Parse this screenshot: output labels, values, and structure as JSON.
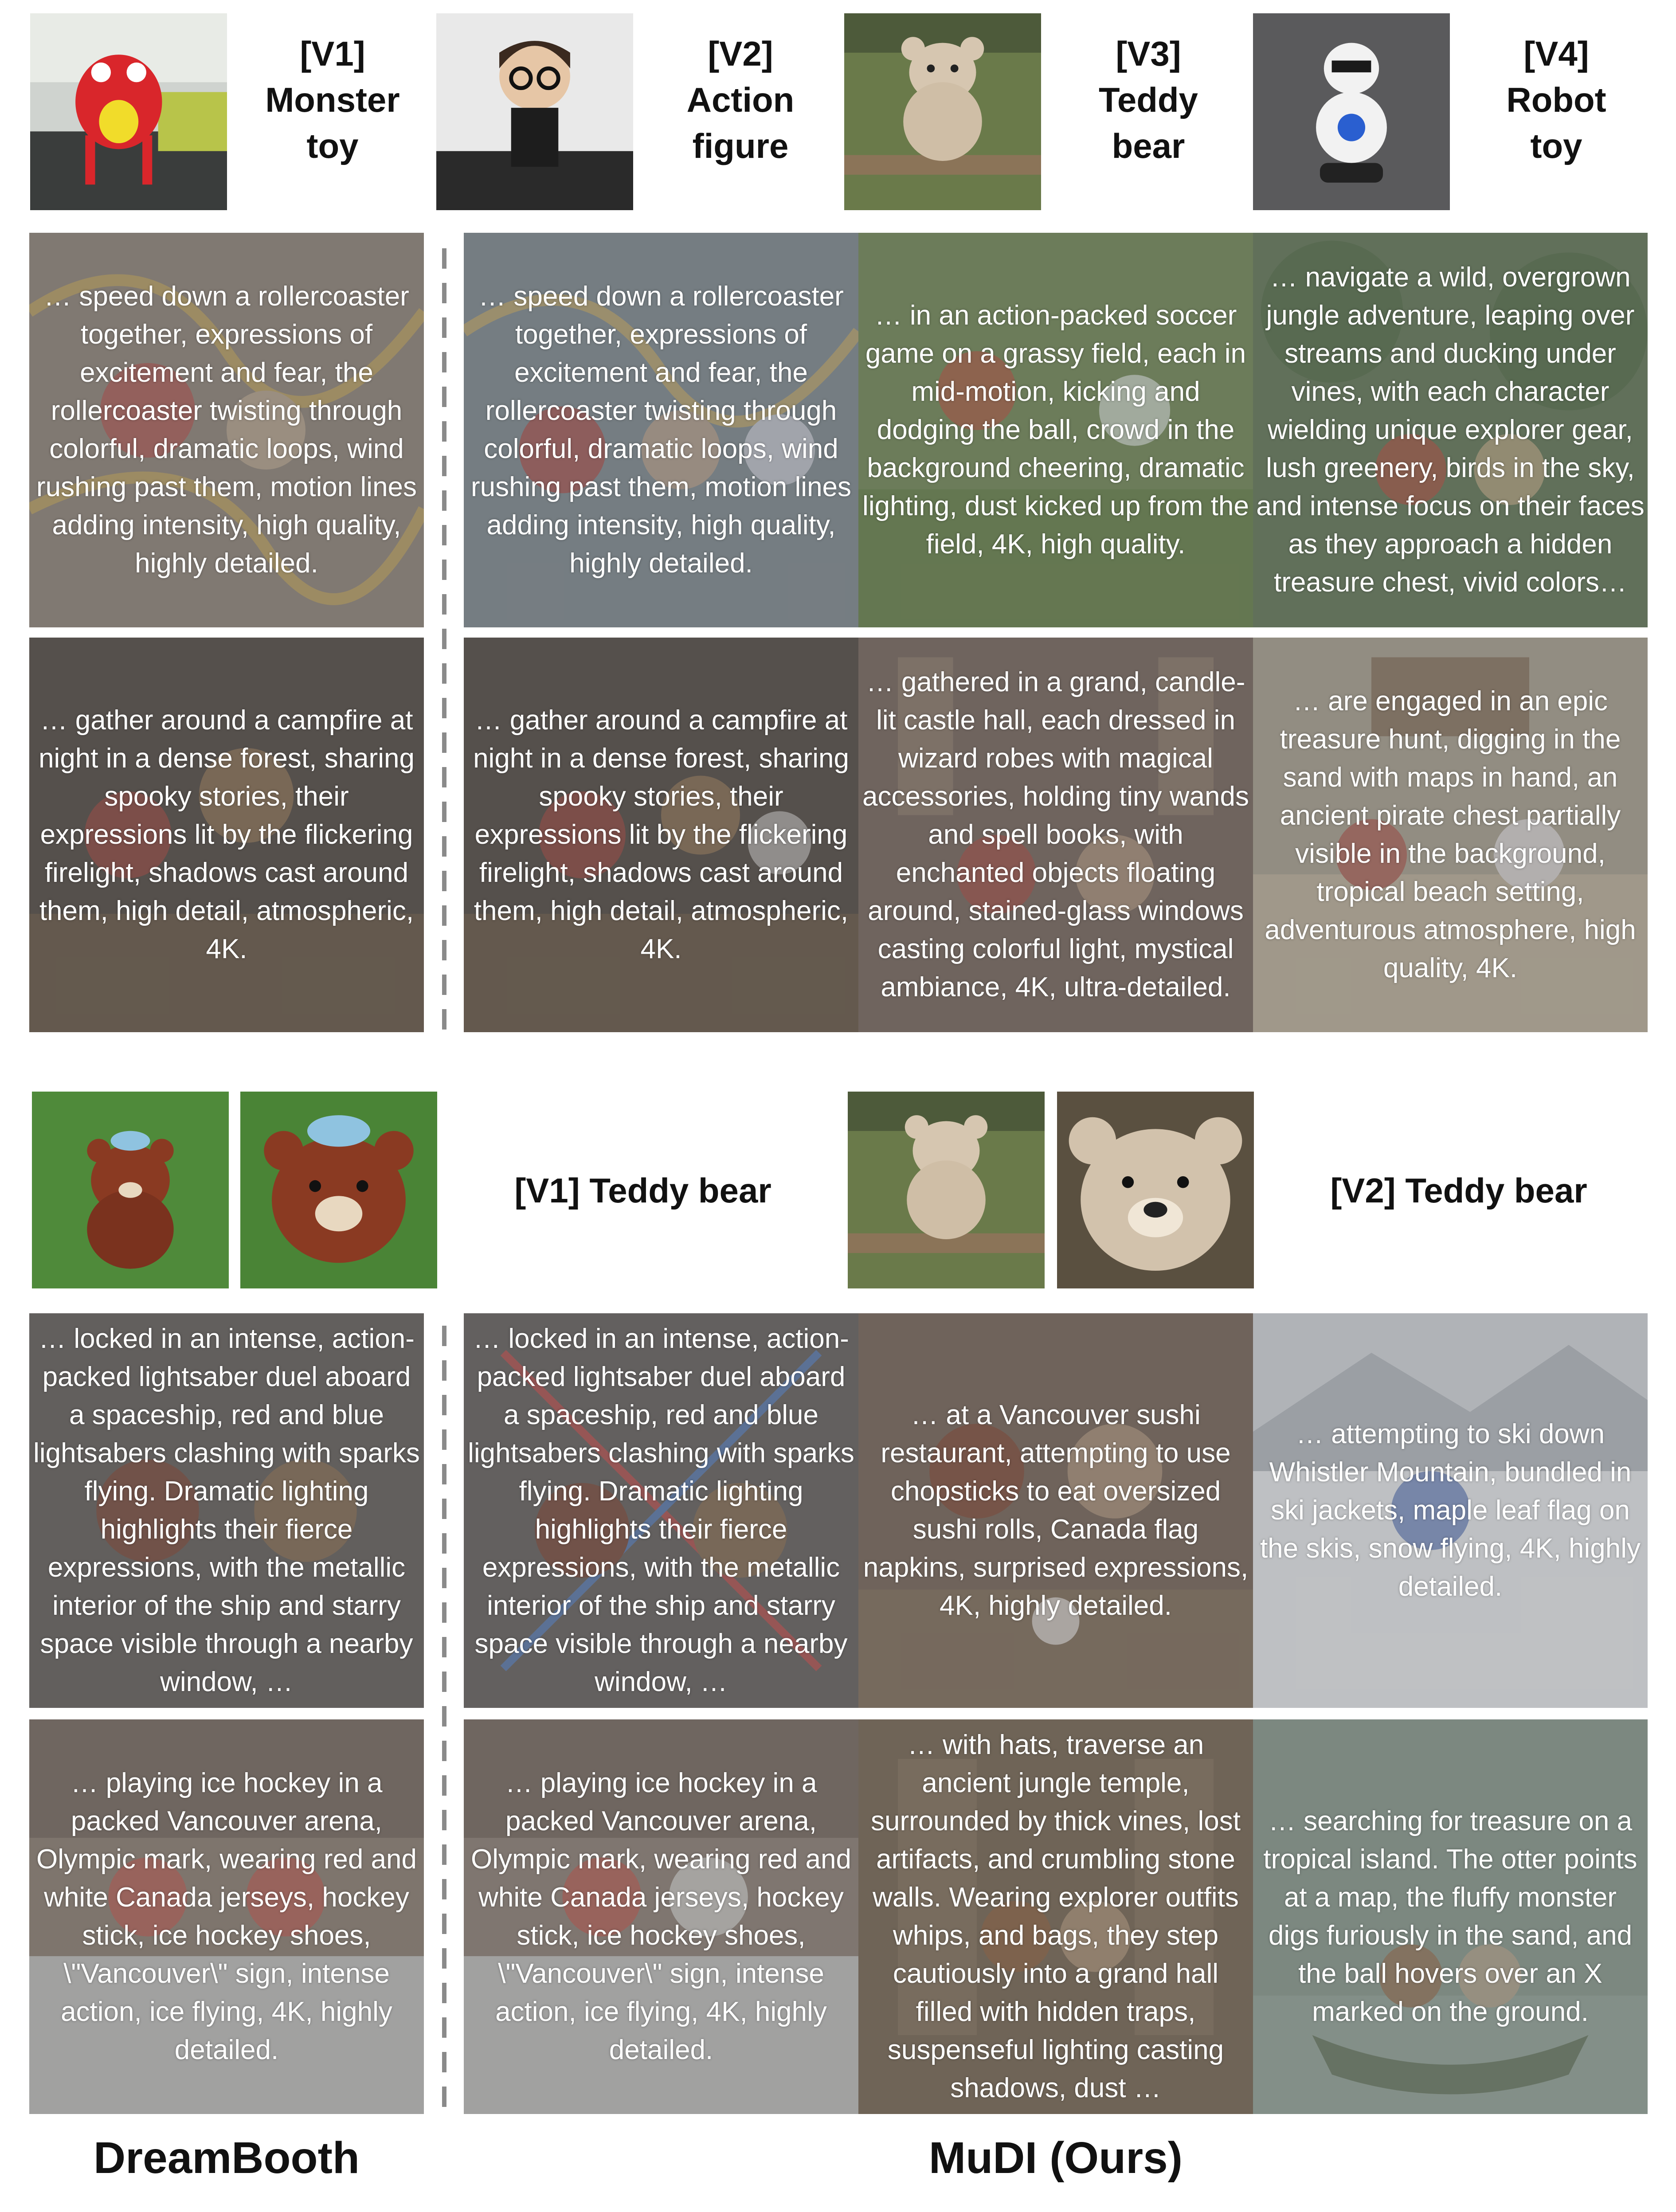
{
  "section1": {
    "headers": [
      {
        "tag": "[V1]",
        "lines": [
          "[V1]",
          "Monster",
          "toy"
        ],
        "photo": "red-monster-toy"
      },
      {
        "tag": "[V2]",
        "lines": [
          "[V2]",
          "Action",
          "figure"
        ],
        "photo": "action-figure"
      },
      {
        "tag": "[V3]",
        "lines": [
          "[V3]",
          "Teddy",
          "bear"
        ],
        "photo": "teddy-bear"
      },
      {
        "tag": "[V4]",
        "lines": [
          "[V4]",
          "Robot",
          "toy"
        ],
        "photo": "robot-toy"
      }
    ],
    "rows": [
      {
        "dreambooth": "… speed down a rollercoaster together, expressions of excitement and fear, the rollercoaster twisting through colorful, dramatic loops, wind rushing past them, motion lines adding intensity, high quality, highly detailed.",
        "mudi": [
          "… speed down a rollercoaster together, expressions of excitement and fear, the rollercoaster twisting through colorful, dramatic loops, wind rushing past them, motion lines adding intensity, high quality, highly detailed.",
          "… in an action-packed soccer game on a grassy field, each in mid-motion, kicking and dodging the ball, crowd in the background cheering, dramatic lighting, dust kicked up from the field, 4K, high quality.",
          "… navigate a wild, overgrown jungle adventure, leaping over streams and ducking under vines, with each character wielding unique explorer gear, lush greenery, birds in the sky, and intense focus on their faces as they approach a hidden treasure chest, vivid colors…"
        ]
      },
      {
        "dreambooth": "… gather around a campfire at night in a dense forest, sharing spooky stories, their expressions lit by the flickering firelight, shadows cast around them, high detail, atmospheric, 4K.",
        "mudi": [
          "… gather around a campfire at night in a dense forest, sharing spooky stories, their expressions lit by the flickering firelight, shadows cast around them, high detail, atmospheric, 4K.",
          "… gathered in a grand, candle-lit castle hall, each dressed in wizard robes with magical accessories, holding tiny wands and spell books, with enchanted objects floating around, stained-glass windows casting colorful light, mystical ambiance, 4K, ultra-detailed.",
          "… are engaged in an epic treasure hunt, digging in the sand with maps in hand, an ancient pirate chest partially visible in the background, tropical beach setting, adventurous atmosphere, high quality, 4K."
        ]
      }
    ]
  },
  "section2": {
    "left_label": "[V1] Teddy bear",
    "right_label": "[V2] Teddy bear",
    "rows": [
      {
        "dreambooth": "… locked in an intense, action-packed lightsaber duel aboard a spaceship, red and blue lightsabers clashing with sparks flying. Dramatic lighting highlights their fierce expressions, with the metallic interior of the ship and starry space visible through a nearby window, …",
        "mudi": [
          "… locked in an intense, action-packed lightsaber duel aboard a spaceship, red and blue lightsabers clashing with sparks flying. Dramatic lighting highlights their fierce expressions, with the metallic interior of the ship and starry space visible through a nearby window, …",
          "… at a Vancouver sushi restaurant, attempting to use chopsticks to eat oversized sushi rolls, Canada flag napkins, surprised expressions, 4K, highly detailed.",
          "… attempting to ski down Whistler Mountain, bundled in ski jackets, maple leaf flag on the skis, snow flying, 4K, highly detailed."
        ]
      },
      {
        "dreambooth": "… playing ice hockey in a packed Vancouver arena, Olympic mark, wearing red and white Canada jerseys, hockey stick, ice hockey shoes, \\\"Vancouver\\\" sign, intense action, ice flying, 4K, highly detailed.",
        "mudi": [
          "… playing ice hockey in a packed Vancouver arena, Olympic mark, wearing red and white Canada jerseys, hockey stick, ice hockey shoes, \\\"Vancouver\\\" sign, intense action, ice flying, 4K, highly detailed.",
          "… with hats, traverse an ancient jungle temple, surrounded by thick vines, lost artifacts, and crumbling stone walls. Wearing explorer outfits whips, and bags, they step cautiously into a grand hall filled with hidden traps, suspenseful lighting casting shadows, dust …",
          "… searching for treasure on a tropical island. The otter points at a map, the fluffy monster digs furiously in the sand, and the ball hovers over an X marked on the ground."
        ]
      }
    ]
  },
  "methods": {
    "left": "DreamBooth",
    "right": "MuDI (Ours)"
  }
}
